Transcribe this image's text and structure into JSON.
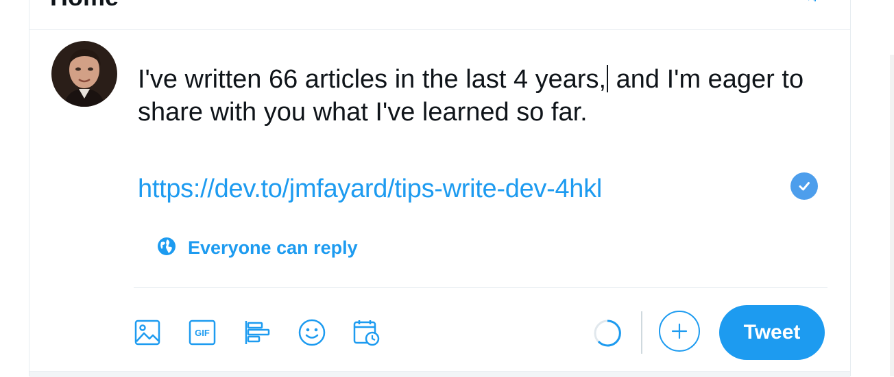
{
  "header": {
    "title": "Home",
    "sparkle_icon": "sparkle-icon"
  },
  "composer": {
    "text_before_caret": "I've written 66 articles in the last 4 years,",
    "text_after_caret": " and I'm eager to share with you what I've learned so far.",
    "link": "https://dev.to/jmfayard/tips-write-dev-4hkl",
    "link_check_icon": "check-circle-icon",
    "reply_setting": "Everyone can reply",
    "reply_icon": "globe-icon"
  },
  "toolbar": {
    "items": [
      "image-icon",
      "gif-icon",
      "poll-icon",
      "emoji-icon",
      "schedule-icon"
    ],
    "gif_label": "GIF",
    "add_icon": "plus-icon",
    "tweet_label": "Tweet"
  },
  "colors": {
    "accent": "#1d9bf0",
    "text": "#0f1419",
    "border": "#e6ecf0"
  }
}
